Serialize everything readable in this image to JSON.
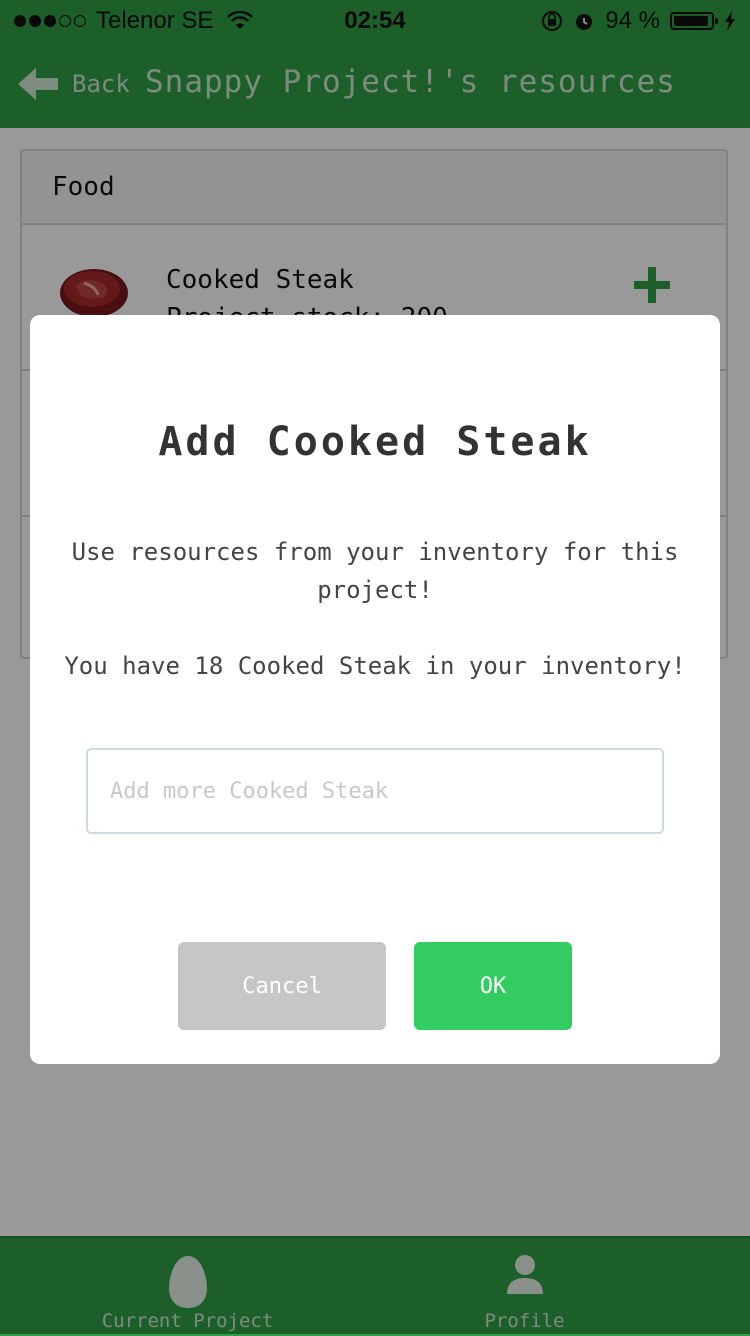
{
  "status_bar": {
    "carrier": "Telenor SE",
    "time": "02:54",
    "battery_percent": "94 %",
    "battery_level": 0.94,
    "signal_bars_filled": 3,
    "signal_bars_total": 5
  },
  "nav": {
    "back_label": "Back",
    "title": "Snappy Project!'s resources"
  },
  "resources": {
    "category": "Food",
    "items": [
      {
        "name": "Cooked Steak",
        "stock": "Project stock: 200",
        "icon": "steak-icon"
      }
    ]
  },
  "modal": {
    "title": "Add Cooked Steak",
    "description": "Use resources from your inventory for this project!",
    "inventory_note": "You have 18 Cooked Steak in your inventory!",
    "input_placeholder": "Add more Cooked Steak",
    "input_value": "",
    "cancel_label": "Cancel",
    "ok_label": "OK"
  },
  "tabbar": {
    "tabs": [
      {
        "label": "Current Project",
        "icon": "egg-icon",
        "active": true
      },
      {
        "label": "Profile",
        "icon": "person-icon",
        "active": false
      }
    ]
  },
  "colors": {
    "brand_green": "#2f9e44",
    "ok_green": "#33cc60",
    "cancel_gray": "#c6c6c6",
    "plus_green": "#2f9e44"
  }
}
